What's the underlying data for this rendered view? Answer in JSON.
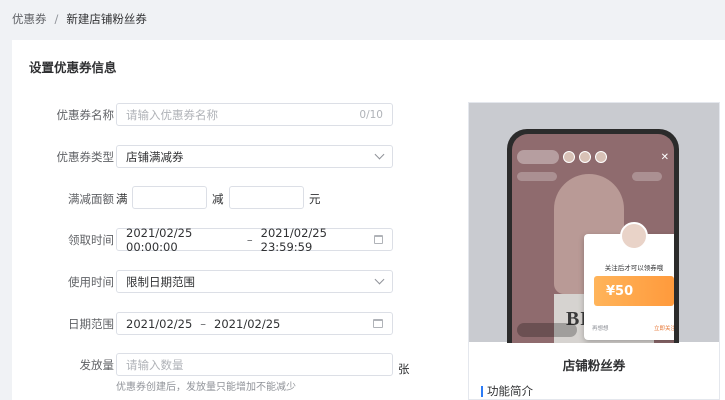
{
  "breadcrumb": {
    "parent": "优惠券",
    "separator": "/",
    "current": "新建店铺粉丝券"
  },
  "section_title": "设置优惠券信息",
  "form": {
    "name": {
      "label": "优惠券名称",
      "placeholder": "请输入优惠券名称",
      "counter": "0/10"
    },
    "type": {
      "label": "优惠券类型",
      "value": "店铺满减券"
    },
    "threshold": {
      "label": "满减面额",
      "full_prefix": "满",
      "minus_text": "减",
      "unit": "元"
    },
    "claim_time": {
      "label": "领取时间",
      "start": "2021/02/25 00:00:00",
      "sep": "–",
      "end": "2021/02/25 23:59:59"
    },
    "use_time": {
      "label": "使用时间",
      "value": "限制日期范围"
    },
    "date_range": {
      "label": "日期范围",
      "start": "2021/02/25",
      "sep": "–",
      "end": "2021/02/25"
    },
    "quantity": {
      "label": "发放量",
      "placeholder": "请输入数量",
      "unit": "张",
      "hint": "优惠券创建后，发放量只能增加不能减少"
    }
  },
  "preview": {
    "popup_title": "关注后才可以领券哦",
    "coupon_amount": "¥50",
    "popup_left": "再想想",
    "popup_right": "立即关注",
    "bag_text": "BLACK",
    "title": "店铺粉丝券",
    "feature_title": "功能简介"
  },
  "colors": {
    "accent": "#2d7cf6",
    "coupon": "#ff9a3c",
    "border": "#dcdfe6"
  }
}
